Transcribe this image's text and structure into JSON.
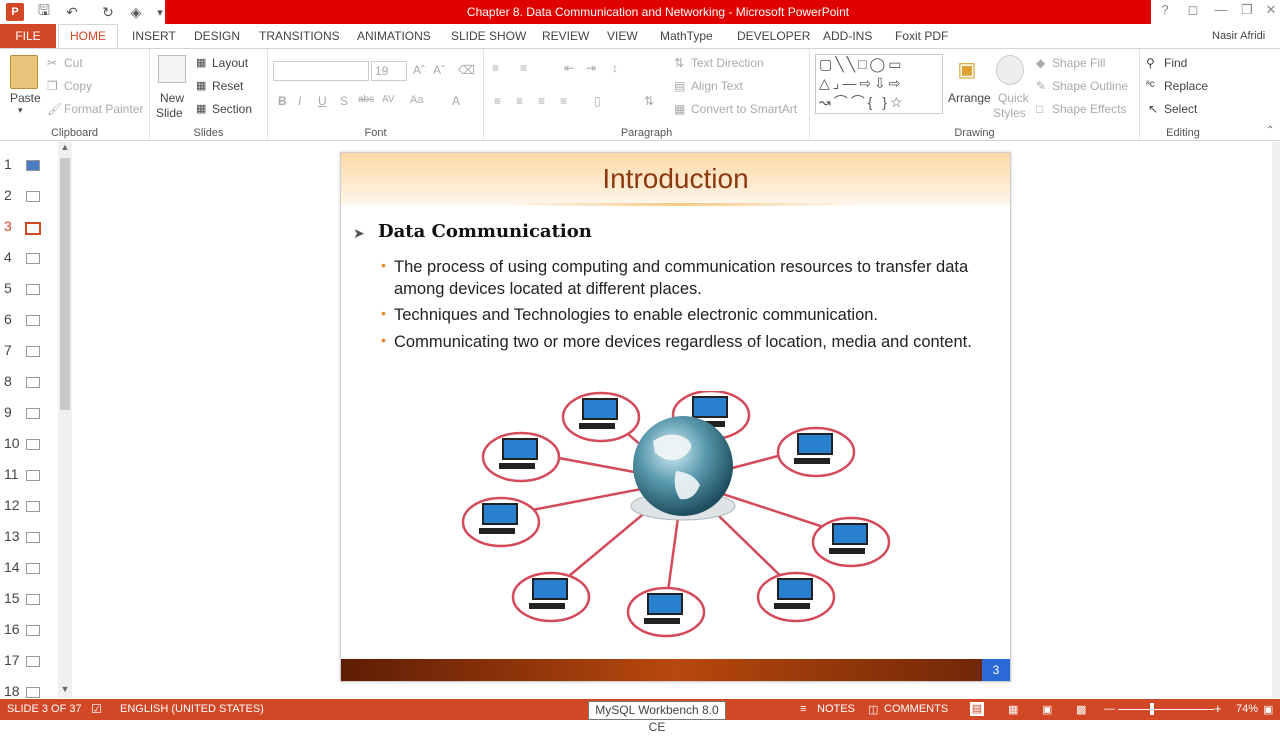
{
  "window": {
    "title": "Chapter 8. Data Communication and Networking -  Microsoft PowerPoint",
    "user": "Nasir Afridi",
    "help": "?"
  },
  "tabs": {
    "file": "FILE",
    "items": [
      "HOME",
      "INSERT",
      "DESIGN",
      "TRANSITIONS",
      "ANIMATIONS",
      "SLIDE SHOW",
      "REVIEW",
      "VIEW",
      "MathType",
      "DEVELOPER",
      "ADD-INS",
      "Foxit PDF"
    ]
  },
  "ribbon": {
    "clipboard": {
      "label": "Clipboard",
      "paste": "Paste",
      "cut": "Cut",
      "copy": "Copy",
      "format_painter": "Format Painter"
    },
    "slides": {
      "label": "Slides",
      "new_slide_1": "New",
      "new_slide_2": "Slide",
      "layout": "Layout",
      "reset": "Reset",
      "section": "Section"
    },
    "font": {
      "label": "Font",
      "size": "19"
    },
    "paragraph": {
      "label": "Paragraph",
      "text_direction": "Text Direction",
      "align_text": "Align Text",
      "convert": "Convert to SmartArt"
    },
    "drawing": {
      "label": "Drawing",
      "arrange": "Arrange",
      "quick_1": "Quick",
      "quick_2": "Styles",
      "shape_fill": "Shape Fill",
      "shape_outline": "Shape Outline",
      "shape_effects": "Shape Effects"
    },
    "editing": {
      "label": "Editing",
      "find": "Find",
      "replace": "Replace",
      "select": "Select"
    }
  },
  "thumbnails": [
    "1",
    "2",
    "3",
    "4",
    "5",
    "6",
    "7",
    "8",
    "9",
    "10",
    "11",
    "12",
    "13",
    "14",
    "15",
    "16",
    "17",
    "18"
  ],
  "slide": {
    "title": "Introduction",
    "heading": "Data Communication",
    "bullets": [
      "The process of using computing and communication resources to transfer data",
      "among devices located at different places.",
      "Techniques and Technologies to enable electronic communication.",
      "Communicating two or more devices regardless of location, media and content."
    ],
    "page_number": "3"
  },
  "status": {
    "slide_info": "SLIDE 3 OF 37",
    "language": "ENGLISH (UNITED STATES)",
    "notes": "NOTES",
    "comments": "COMMENTS",
    "zoom": "74%",
    "tooltip": "MySQL Workbench 8.0 CE"
  },
  "colors": {
    "accent": "#d24726",
    "title_red": "#e00000",
    "slide_title": "#8b3a10",
    "bullet": "#e8862a"
  }
}
